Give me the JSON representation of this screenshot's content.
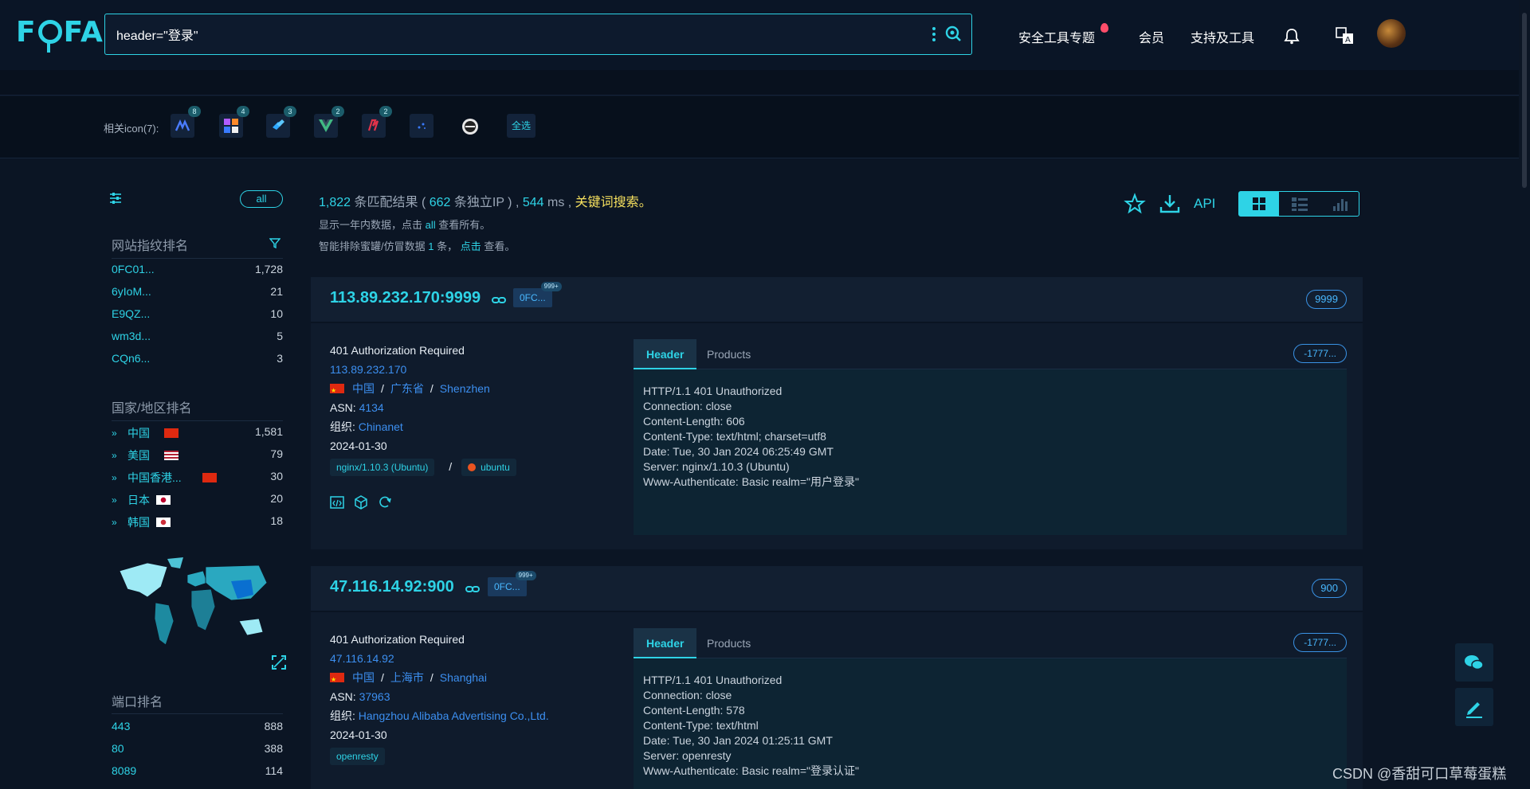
{
  "header": {
    "logo": "FOFA",
    "search_value": "header=\"登录\"",
    "nav": [
      "安全工具专题",
      "会员",
      "支持及工具"
    ]
  },
  "icons_bar": {
    "label": "相关icon(7):",
    "counts": [
      "8",
      "4",
      "3",
      "2",
      "2"
    ],
    "select_all": "全选"
  },
  "sidebar": {
    "all_label": "all",
    "fingerprint_title": "网站指纹排名",
    "fingerprints": [
      {
        "k": "0FC01...",
        "v": "1,728"
      },
      {
        "k": "6yIoM...",
        "v": "21"
      },
      {
        "k": "E9QZ...",
        "v": "10"
      },
      {
        "k": "wm3d...",
        "v": "5"
      },
      {
        "k": "CQn6...",
        "v": "3"
      }
    ],
    "country_title": "国家/地区排名",
    "countries": [
      {
        "k": "中国",
        "v": "1,581"
      },
      {
        "k": "美国",
        "v": "79"
      },
      {
        "k": "中国香港...",
        "v": "30"
      },
      {
        "k": "日本",
        "v": "20"
      },
      {
        "k": "韩国",
        "v": "18"
      }
    ],
    "port_title": "端口排名",
    "ports": [
      {
        "k": "443",
        "v": "888"
      },
      {
        "k": "80",
        "v": "388"
      },
      {
        "k": "8089",
        "v": "114"
      }
    ]
  },
  "summary": {
    "count": "1,822",
    "count_label": "条匹配结果 (",
    "ip": "662",
    "ip_label": "条独立IP ) ,",
    "ms": "544",
    "ms_label": "ms ,",
    "keyword": "关键词搜索",
    "line2_a": "显示一年内数据，点击",
    "line2_all": "all",
    "line2_b": "查看所有。",
    "line3_a": "智能排除蜜罐/仿冒数据",
    "line3_n": "1",
    "line3_b": "条，",
    "line3_click": "点击",
    "line3_c": "查看。",
    "api": "API"
  },
  "results": [
    {
      "host": "113.89.232.170:9999",
      "tag": "0FC...",
      "tag_badge": "999+",
      "port": "9999",
      "title": "401 Authorization Required",
      "ip": "113.89.232.170",
      "country": "中国",
      "province": "广东省",
      "city": "Shenzhen",
      "asn_label": "ASN:",
      "asn": "4134",
      "org_label": "组织:",
      "org": "Chinanet",
      "date": "2024-01-30",
      "softs": [
        "nginx/1.10.3 (Ubuntu)",
        "ubuntu"
      ],
      "tab_header": "Header",
      "tab_products": "Products",
      "hash": "-1777...",
      "header_text": "HTTP/1.1 401 Unauthorized\nConnection: close\nContent-Length: 606\nContent-Type: text/html; charset=utf8\nDate: Tue, 30 Jan 2024 06:25:49 GMT\nServer: nginx/1.10.3 (Ubuntu)\nWww-Authenticate: Basic realm=\"用户登录\""
    },
    {
      "host": "47.116.14.92:900",
      "tag": "0FC...",
      "tag_badge": "999+",
      "port": "900",
      "title": "401 Authorization Required",
      "ip": "47.116.14.92",
      "country": "中国",
      "province": "上海市",
      "city": "Shanghai",
      "asn_label": "ASN:",
      "asn": "37963",
      "org_label": "组织:",
      "org": "Hangzhou Alibaba Advertising Co.,Ltd.",
      "date": "2024-01-30",
      "softs": [
        "openresty"
      ],
      "tab_header": "Header",
      "tab_products": "Products",
      "hash": "-1777...",
      "header_text": "HTTP/1.1 401 Unauthorized\nConnection: close\nContent-Length: 578\nContent-Type: text/html\nDate: Tue, 30 Jan 2024 01:25:11 GMT\nServer: openresty\nWww-Authenticate: Basic realm=\"登录认证\""
    }
  ],
  "watermark": "CSDN @香甜可口草莓蛋糕",
  "colors": {
    "accent": "#2ed3e6",
    "link": "#3c8ff0",
    "bg": "#0b1524"
  }
}
